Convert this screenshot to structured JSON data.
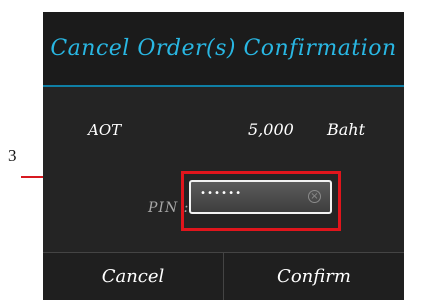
{
  "annotation": {
    "number": "3"
  },
  "dialog": {
    "title": "Cancel Order(s) Confirmation",
    "order": {
      "stock": "AOT",
      "amount": "5,000",
      "currency": "Baht"
    },
    "pin": {
      "label": "PIN :",
      "value": "••••••",
      "clear_icon": "clear-circle-icon"
    },
    "buttons": {
      "cancel": "Cancel",
      "confirm": "Confirm"
    }
  },
  "colors": {
    "title": "#29b7e3",
    "highlight": "#e0151c",
    "dialog_background": "#242424"
  }
}
